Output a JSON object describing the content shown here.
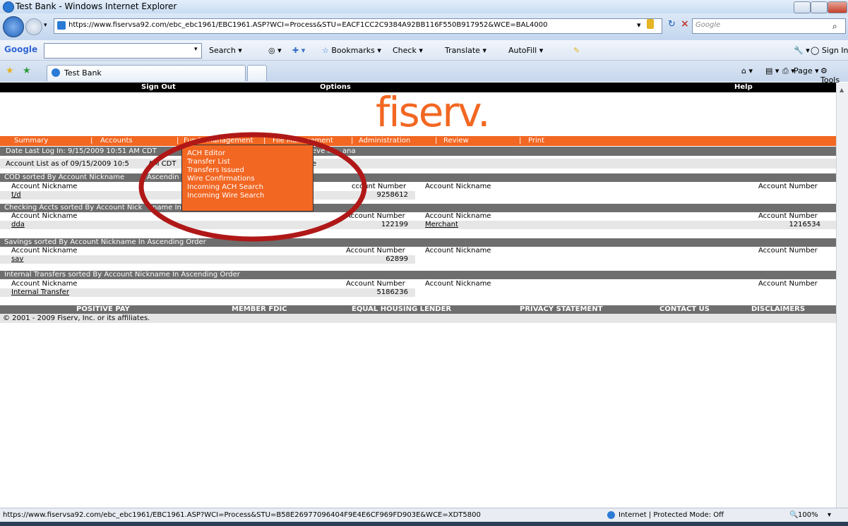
{
  "window": {
    "title": "Test Bank - Windows Internet Explorer"
  },
  "address": {
    "url": "https://www.fiservsa92.com/ebc_ebc1961/EBC1961.ASP?WCI=Process&STU=EACF1CC2C9384A92BB116F550B917952&WCE=BAL4000",
    "search_placeholder": "Google"
  },
  "toolbar": {
    "google_label": "Google",
    "search_label": "Search",
    "bookmarks_label": "Bookmarks",
    "check_label": "Check",
    "translate_label": "Translate",
    "autofill_label": "AutoFill",
    "signin_label": "Sign In"
  },
  "tabs": {
    "active_label": "Test Bank",
    "page_label": "Page",
    "tools_label": "Tools"
  },
  "site": {
    "topnav": [
      "Sign Out",
      "Options",
      "Help"
    ],
    "logo_text": "fiserv.",
    "menu": [
      "Summary",
      "Accounts",
      "Funds Management",
      "File Management",
      "Administration",
      "Review",
      "Print"
    ],
    "last_login": "Date Last Log In: 9/15/2009 10:51 AM CDT",
    "last_login_tail": "eve In",
    "last_login_tail2": "ana",
    "account_list": "Account List as of 09/15/2009 10:5",
    "account_list_mid": "AM CDT",
    "account_list_tail": "e",
    "dropdown": [
      "ACH Editor",
      "Transfer List",
      "Transfers Issued",
      "Wire Confirmations",
      "Incoming ACH Search",
      "Incoming Wire Search"
    ],
    "col_nickname": "Account Nickname",
    "col_number": "Account Number",
    "col_number_partial": "ccount Number",
    "sections": [
      {
        "title": "COD sorted By Account Nickname",
        "title_tail": "Ascendin",
        "left_name": "t/d",
        "left_number": "9258612",
        "right_name": "",
        "right_number": ""
      },
      {
        "title": "Checking Accts sorted By Account Nick",
        "title_tail": "name In",
        "left_name": "dda",
        "left_number": "122199",
        "right_name": "Merchant",
        "right_number": "1216534"
      },
      {
        "title": "Savings sorted By Account Nickname In Ascending Order",
        "title_tail": "",
        "left_name": "sav",
        "left_number": "62899",
        "right_name": "",
        "right_number": ""
      },
      {
        "title": "Internal Transfers sorted By Account Nickname In Ascending Order",
        "title_tail": "",
        "left_name": "Internal Transfer",
        "left_number": "5186236",
        "right_name": "",
        "right_number": ""
      }
    ],
    "bottomnav": [
      "POSITIVE PAY",
      "MEMBER FDIC",
      "EQUAL HOUSING LENDER",
      "PRIVACY STATEMENT",
      "CONTACT US",
      "DISCLAIMERS"
    ],
    "copyright": "© 2001 - 2009 Fiserv, Inc. or its affiliates."
  },
  "status": {
    "url": "https://www.fiservsa92.com/ebc_ebc1961/EBC1961.ASP?WCI=Process&STU=B58E26977096404F9E4E6CF969FD903E&WCE=XDT5800",
    "zone": "Internet | Protected Mode: Off",
    "zoom": "100%"
  },
  "colors": {
    "brand_orange": "#f26722",
    "band_gray": "#6e6e6e",
    "annotation_red": "#b01818"
  }
}
